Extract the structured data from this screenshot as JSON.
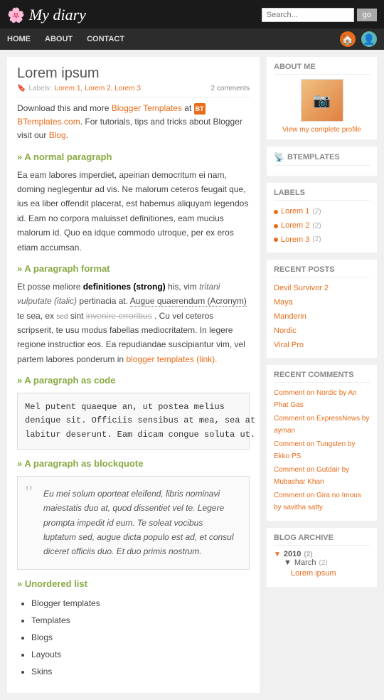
{
  "header": {
    "logo_icon": "🌸",
    "site_title": "My diary",
    "search_placeholder": "Search...",
    "search_button_label": "go"
  },
  "nav": {
    "items": [
      {
        "label": "HOME"
      },
      {
        "label": "ABOUT"
      },
      {
        "label": "CONTACT"
      }
    ],
    "icon1": "🏠",
    "icon2": "👤"
  },
  "post": {
    "title": "Lorem ipsum",
    "meta_label": "Labels:",
    "labels": [
      "Lorem 1",
      "Lorem 2",
      "Lorem 3"
    ],
    "comments_count": "2 comments",
    "intro1": "Download this and more",
    "intro_link": "Blogger Templates",
    "intro2": "at",
    "bt_text": "BTemplates.com",
    "intro3": ". For tutorials, tips and tricks about Blogger visit our",
    "intro_blog_link": "Blog",
    "section1_heading": "» A normal paragraph",
    "section1_body": "Ea eam labores imperdiet, apeirian democritum ei nam, doming neglegentur ad vis. Ne malorum ceteros feugait que, ius ea liber offendit placerat, est habemus aliquyam legendos id. Eam no corpora maluisset definitiones, eam mucius malorum id. Quo ea idque commodo utroque, per ex eros etiam accumsan.",
    "section2_heading": "» A paragraph format",
    "section2_pre": "Et posse meliore",
    "section2_strong": "definitiones (strong)",
    "section2_mid": "his, vim",
    "section2_italic": "tritani vulputate (italic)",
    "section2_post1": "pertinacia at.",
    "section2_abbr": "Augue quaerendum (Acronym)",
    "section2_post2": "te sea, ex",
    "section2_sed": "sed",
    "section2_sint": "sint",
    "section2_strike": "invenire erroribus",
    "section2_post3": ". Cu vel ceteros scripserit, te usu modus fabellas mediocritatem. In legere regione instructior eos. Ea repudiandae suscipiantur vim, vel partem labores ponderum in",
    "section2_link": "blogger templates (link).",
    "section3_heading": "» A paragraph as code",
    "section3_code": "Mel putent quaeque an, ut postea melius\ndenique sit. Officiis sensibus at mea, sea at\nlabitur deserunt. Eam dicam congue soluta ut.",
    "section4_heading": "» A paragraph as blockquote",
    "section4_quote": "Eu mei solum oporteat eleifend, libris nominavi maiestatis duo at, quod dissentiet vel te. Legere prompta impedit id eum. Te soleat vocibus luptatum sed, augue dicta populo est ad, et consul diceret officiis duo. Et duo primis nostrum.",
    "section5_heading": "» Unordered list",
    "list_items": [
      "Blogger templates",
      "Templates",
      "Blogs",
      "Layouts",
      "Skins"
    ]
  },
  "sidebar": {
    "about_me": {
      "title": "ABOUT ME",
      "view_link": "View my complete profile"
    },
    "btemplates": {
      "title": "BTEMPLATES",
      "icon": "BT"
    },
    "labels": {
      "title": "LABELS",
      "items": [
        {
          "name": "Lorem 1",
          "count": "(2)"
        },
        {
          "name": "Lorem 2",
          "count": "(2)"
        },
        {
          "name": "Lorem 3",
          "count": "(2)"
        }
      ]
    },
    "recent_posts": {
      "title": "RECENT POSTS",
      "items": [
        "Devil Survivor 2",
        "Maya",
        "Manderin",
        "Nordic",
        "Viral Pro"
      ]
    },
    "recent_comments": {
      "title": "RECENT COMMENTS",
      "items": [
        "Comment on Nordic by An Phat Gas",
        "Comment on ExpressNews by ayman",
        "Comment on Tungsten by Ekko PS",
        "Comment on Gutdair by Mubashar Khan",
        "Comment on Gira no Imous by savitha satty"
      ]
    },
    "blog_archive": {
      "title": "BLOG ARCHIVE",
      "years": [
        {
          "year": "2010",
          "count": "(2)",
          "expanded": true,
          "months": [
            {
              "name": "March",
              "count": "(2)",
              "expanded": true,
              "posts": [
                "Lorem ipsum"
              ]
            }
          ]
        }
      ]
    }
  }
}
